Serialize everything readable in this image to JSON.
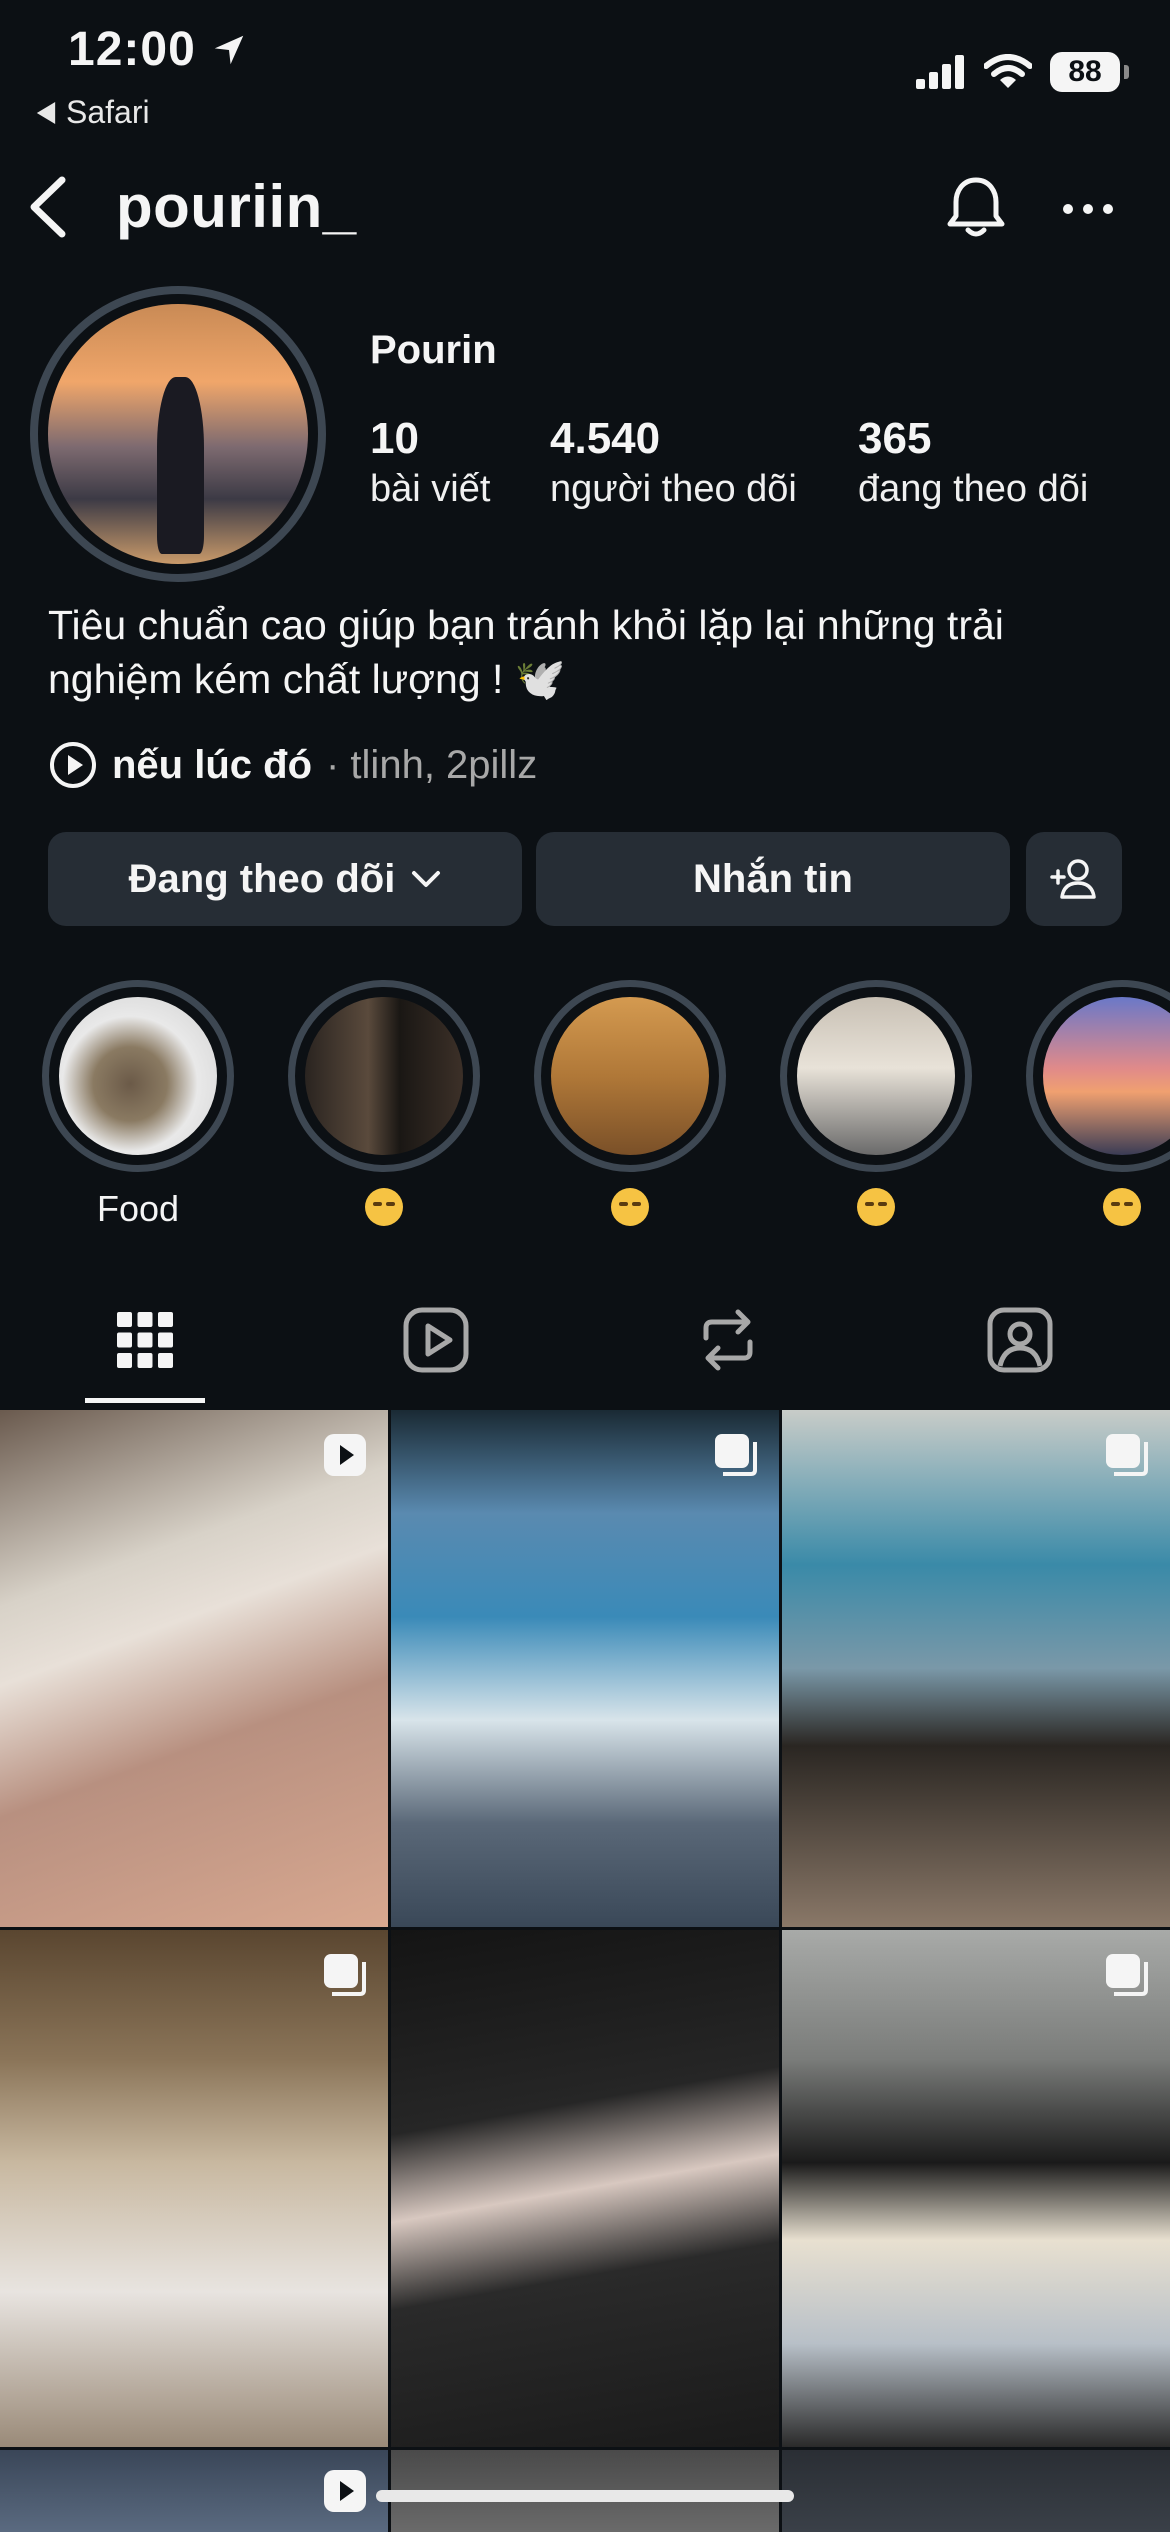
{
  "status_bar": {
    "time": "12:00",
    "back_app": "Safari",
    "battery": "88"
  },
  "header": {
    "username": "pouriin_"
  },
  "profile": {
    "display_name": "Pourin",
    "stats": [
      {
        "value": "10",
        "label": "bài viết"
      },
      {
        "value": "4.540",
        "label": "người theo dõi"
      },
      {
        "value": "365",
        "label": "đang theo dõi"
      }
    ],
    "bio": "Tiêu chuẩn cao giúp bạn tránh khỏi lặp lại những trải nghiệm kém chất lượng ! 🕊️",
    "music_song": "nếu lúc đó",
    "music_artists": "· tlinh, 2pillz"
  },
  "buttons": {
    "following": "Đang theo dõi",
    "message": "Nhắn tin"
  },
  "highlights": [
    {
      "label": "Food",
      "icon": "text"
    },
    {
      "label": "",
      "icon": "pensive-face-emoji"
    },
    {
      "label": "",
      "icon": "pensive-face-emoji"
    },
    {
      "label": "",
      "icon": "woozy-face-emoji"
    },
    {
      "label": "",
      "icon": "nerd-face-emoji"
    }
  ],
  "tabs": [
    "grid-icon",
    "reels-icon",
    "reposts-icon",
    "tagged-icon"
  ],
  "colors": {
    "background": "#0c1014",
    "button": "#262d35",
    "ring": "#3d4752",
    "muted_text": "#a8a8a8"
  }
}
